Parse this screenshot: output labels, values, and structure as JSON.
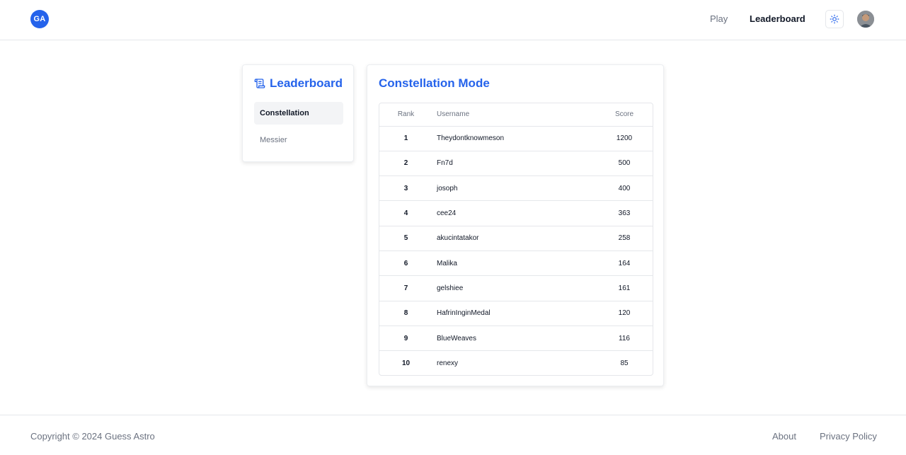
{
  "header": {
    "logo_text": "GA",
    "nav": {
      "play": "Play",
      "leaderboard": "Leaderboard"
    },
    "theme_icon": "sun-icon",
    "avatar_icon": "user-avatar"
  },
  "sidebar": {
    "title": "Leaderboard",
    "title_icon": "scroll-icon",
    "items": [
      {
        "label": "Constellation",
        "active": true
      },
      {
        "label": "Messier",
        "active": false
      }
    ]
  },
  "main": {
    "title": "Constellation Mode",
    "columns": [
      "Rank",
      "Username",
      "Score"
    ],
    "rows": [
      {
        "rank": "1",
        "username": "Theydontknowmeson",
        "score": "1200"
      },
      {
        "rank": "2",
        "username": "Fn7d",
        "score": "500"
      },
      {
        "rank": "3",
        "username": "josoph",
        "score": "400"
      },
      {
        "rank": "4",
        "username": "cee24",
        "score": "363"
      },
      {
        "rank": "5",
        "username": "akucintatakor",
        "score": "258"
      },
      {
        "rank": "6",
        "username": "Malika",
        "score": "164"
      },
      {
        "rank": "7",
        "username": "gelshiee",
        "score": "161"
      },
      {
        "rank": "8",
        "username": "HafrinInginMedal",
        "score": "120"
      },
      {
        "rank": "9",
        "username": "BlueWeaves",
        "score": "116"
      },
      {
        "rank": "10",
        "username": "renexy",
        "score": "85"
      }
    ]
  },
  "footer": {
    "copyright": "Copyright © 2024 Guess Astro",
    "about": "About",
    "privacy": "Privacy Policy"
  },
  "colors": {
    "accent": "#2563eb",
    "muted": "#6b7280",
    "border": "#e5e7eb"
  }
}
